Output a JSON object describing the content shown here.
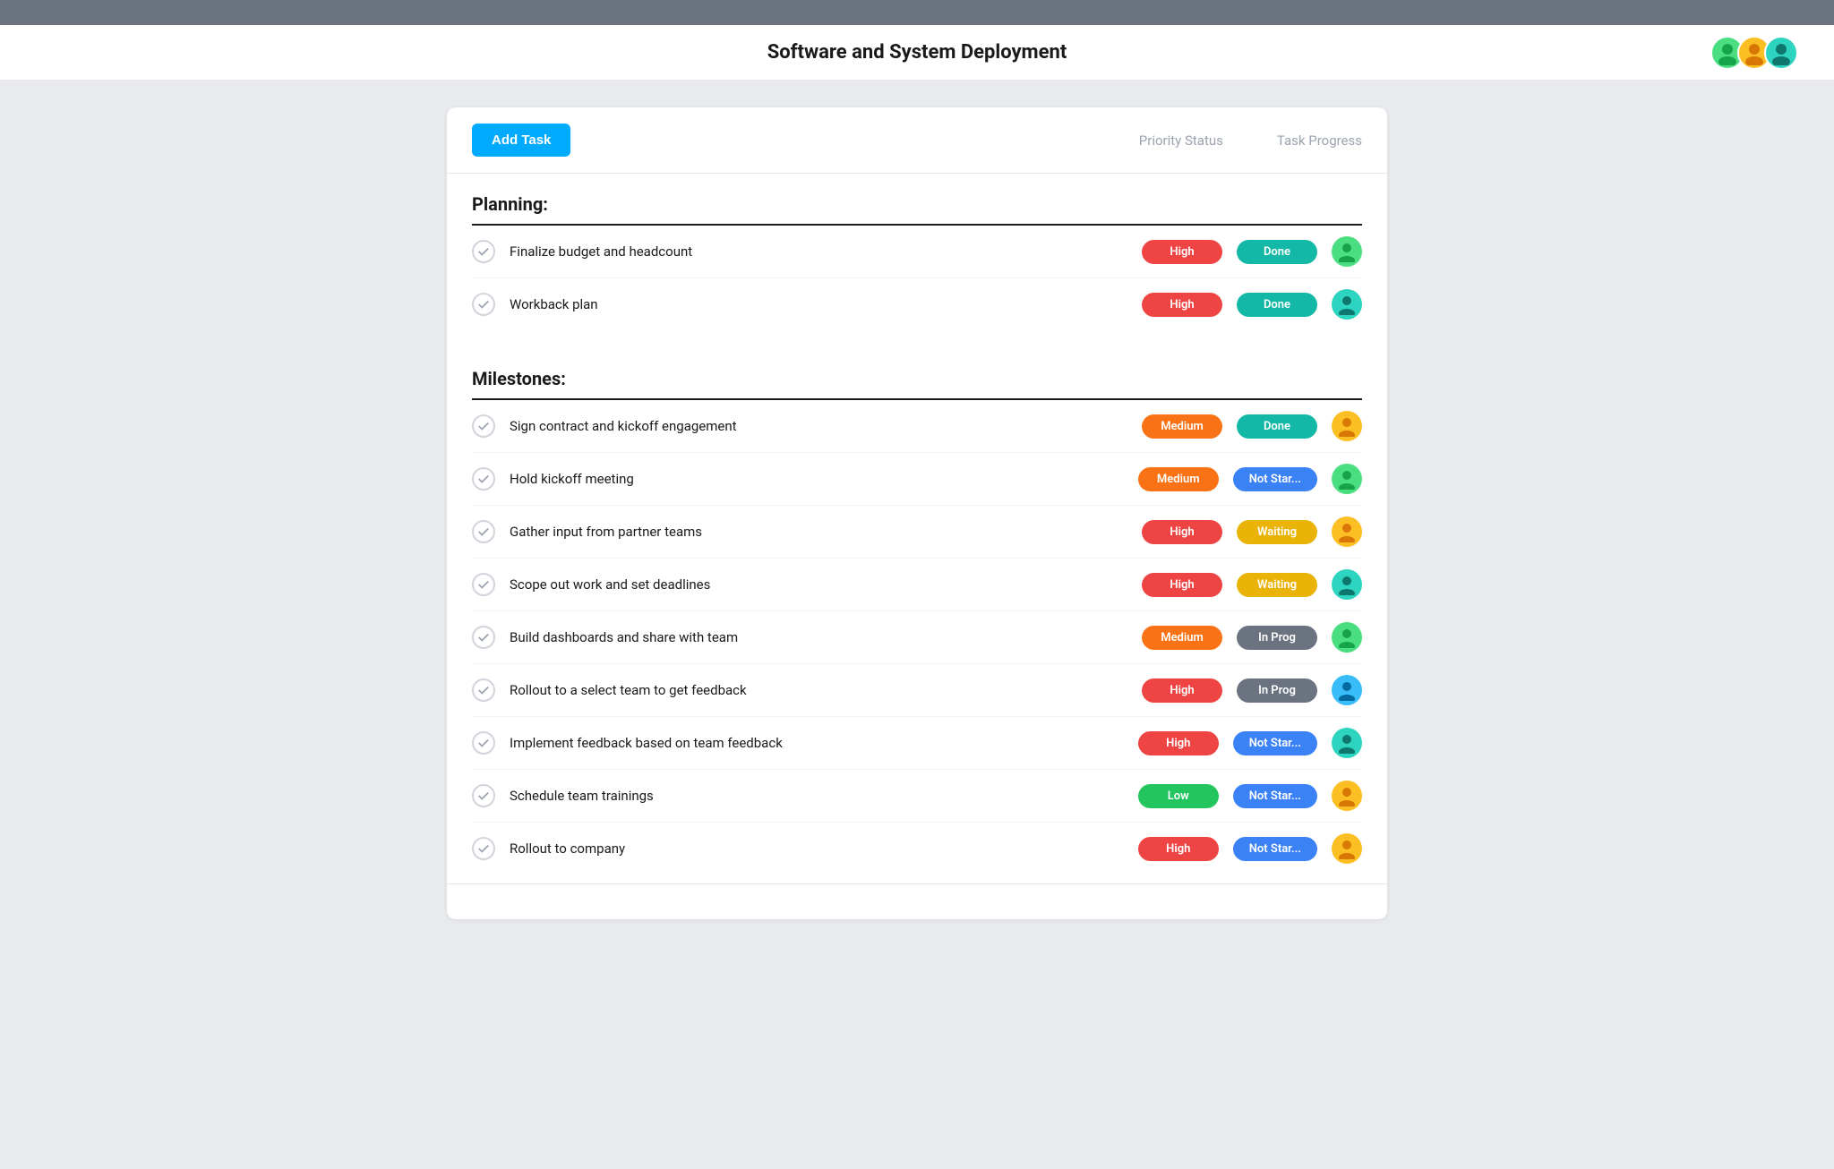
{
  "topBar": {},
  "header": {
    "title": "Software and System Deployment",
    "avatars": [
      {
        "color": "av-green",
        "icon": "👤"
      },
      {
        "color": "av-yellow",
        "icon": "👤"
      },
      {
        "color": "av-teal",
        "icon": "👤"
      }
    ]
  },
  "toolbar": {
    "addTaskLabel": "Add Task",
    "col1": "Priority Status",
    "col2": "Task Progress"
  },
  "sections": [
    {
      "title": "Planning:",
      "tasks": [
        {
          "name": "Finalize budget and headcount",
          "priority": "High",
          "priorityClass": "priority-high",
          "status": "Done",
          "statusClass": "status-done",
          "avatarClass": "av-green",
          "avatarIcon": "👤"
        },
        {
          "name": "Workback plan",
          "priority": "High",
          "priorityClass": "priority-high",
          "status": "Done",
          "statusClass": "status-done",
          "avatarClass": "av-teal",
          "avatarIcon": "👤"
        }
      ]
    },
    {
      "title": "Milestones:",
      "tasks": [
        {
          "name": "Sign contract and kickoff engagement",
          "priority": "Medium",
          "priorityClass": "priority-medium",
          "status": "Done",
          "statusClass": "status-done",
          "avatarClass": "av-yellow",
          "avatarIcon": "👤"
        },
        {
          "name": "Hold kickoff meeting",
          "priority": "Medium",
          "priorityClass": "priority-medium",
          "status": "Not Star...",
          "statusClass": "status-not-started",
          "avatarClass": "av-green",
          "avatarIcon": "👤"
        },
        {
          "name": "Gather input from partner teams",
          "priority": "High",
          "priorityClass": "priority-high",
          "status": "Waiting",
          "statusClass": "status-waiting",
          "avatarClass": "av-yellow",
          "avatarIcon": "👤"
        },
        {
          "name": "Scope out work and set deadlines",
          "priority": "High",
          "priorityClass": "priority-high",
          "status": "Waiting",
          "statusClass": "status-waiting",
          "avatarClass": "av-teal",
          "avatarIcon": "👤"
        },
        {
          "name": "Build dashboards and share with team",
          "priority": "Medium",
          "priorityClass": "priority-medium",
          "status": "In Prog",
          "statusClass": "status-in-progress",
          "avatarClass": "av-green",
          "avatarIcon": "👤"
        },
        {
          "name": "Rollout to a select team to get feedback",
          "priority": "High",
          "priorityClass": "priority-high",
          "status": "In Prog",
          "statusClass": "status-in-progress",
          "avatarClass": "av-blue",
          "avatarIcon": "👤"
        },
        {
          "name": "Implement feedback based on team feedback",
          "priority": "High",
          "priorityClass": "priority-high",
          "status": "Not Star...",
          "statusClass": "status-not-started",
          "avatarClass": "av-teal",
          "avatarIcon": "👤"
        },
        {
          "name": "Schedule team trainings",
          "priority": "Low",
          "priorityClass": "priority-low",
          "status": "Not Star...",
          "statusClass": "status-not-started",
          "avatarClass": "av-yellow",
          "avatarIcon": "👤"
        },
        {
          "name": "Rollout to company",
          "priority": "High",
          "priorityClass": "priority-high",
          "status": "Not Star...",
          "statusClass": "status-not-started",
          "avatarClass": "av-yellow",
          "avatarIcon": "👤"
        }
      ]
    }
  ]
}
